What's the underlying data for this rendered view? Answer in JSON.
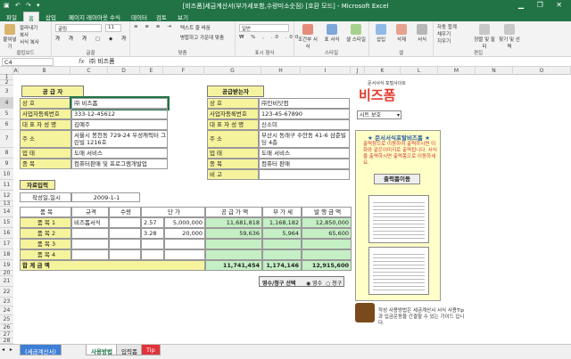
{
  "window": {
    "title": "[비즈폼]세금계산서(부가세포함,수량미소숫점) [호환 모드] - Microsoft Excel"
  },
  "ribbon_tabs": [
    "파일",
    "홈",
    "삽입",
    "페이지 레이아웃",
    "수식",
    "데이터",
    "검토",
    "보기"
  ],
  "ribbon": {
    "clipboard": {
      "paste": "붙여넣기",
      "cut": "잘라내기",
      "copy": "복사",
      "format_painter": "서식 복사",
      "label": "클립보드"
    },
    "font": {
      "name": "굴림",
      "size": "11",
      "label": "글꼴"
    },
    "alignment": {
      "wrap": "텍스트 줄 바꿈",
      "merge": "병합하고 가운데 맞춤",
      "label": "맞춤"
    },
    "number": {
      "format": "일반",
      "label": "표시 형식"
    },
    "styles": {
      "cond": "조건부 서식",
      "table": "표 서식",
      "cell": "셀 스타일",
      "label": "스타일"
    },
    "cells": {
      "insert": "삽입",
      "delete": "삭제",
      "format": "서식",
      "label": "셀"
    },
    "editing": {
      "autosum": "자동 합계",
      "fill": "채우기",
      "clear": "지우기",
      "sort": "정렬 및 필터",
      "find": "찾기 및 선택",
      "label": "편집"
    }
  },
  "formula_bar": {
    "name_box": "C4",
    "fx": "fx",
    "value": "㈜ 비즈폼"
  },
  "columns": [
    "A",
    "B",
    "C",
    "D",
    "E",
    "F",
    "G",
    "H",
    "I",
    "J",
    "K",
    "L",
    "M",
    "N",
    "O"
  ],
  "rows": [
    "1",
    "2",
    "3",
    "4",
    "5",
    "6",
    "7",
    "8",
    "9",
    "10",
    "11",
    "12",
    "13",
    "14",
    "15",
    "16",
    "17",
    "18",
    "19",
    "20",
    "21",
    "22",
    "23",
    "24",
    "25",
    "26",
    "27",
    "28"
  ],
  "supplier": {
    "header": "공 급 자",
    "labels": [
      "상 호",
      "사업자등록번호",
      "대 표 자 성 명",
      "주 소",
      "업 태",
      "종 목"
    ],
    "values": [
      "㈜ 비즈폼",
      "333-12-45612",
      "김예주",
      "서울시 봉천동 729-24 우성캐릭터 그린빌 1216호",
      "도매 서비스",
      "컴퓨터판매 및 프로그램개발업"
    ]
  },
  "buyer": {
    "header": "공급받는자",
    "labels": [
      "상 호",
      "사업자등록번호",
      "대 표 자 성 명",
      "주 소",
      "업 태",
      "종 목",
      "비 고"
    ],
    "values": [
      "㈜인비닷컴",
      "123-45-67890",
      "신소미",
      "부산시 동래구 수안동 41-6 삼준빌딩 4층",
      "도매 서비스",
      "컴퓨터 판매",
      ""
    ]
  },
  "input_section": {
    "header": "자료입력",
    "date_label": "작성일,일시",
    "date_value": "2009-1-1"
  },
  "items_table": {
    "headers": [
      "품 목",
      "규격",
      "수량",
      "단 가",
      "공 급 가 액",
      "부 가 세",
      "발 행 금 액"
    ],
    "rows": [
      {
        "label": "품 목 1",
        "name": "비즈폼서식",
        "spec": "",
        "qty": "2.57",
        "price": "5,000,000",
        "supply": "11,681,818",
        "tax": "1,168,182",
        "total": "12,850,000"
      },
      {
        "label": "품 목 2",
        "name": "",
        "spec": "",
        "qty": "3.28",
        "price": "20,000",
        "supply": "59,636",
        "tax": "5,964",
        "total": "65,600"
      },
      {
        "label": "품 목 3",
        "name": "",
        "spec": "",
        "qty": "",
        "price": "",
        "supply": "",
        "tax": "",
        "total": ""
      },
      {
        "label": "품 목 4",
        "name": "",
        "spec": "",
        "qty": "",
        "price": "",
        "supply": "",
        "tax": "",
        "total": ""
      }
    ],
    "total_label": "합 계 금 액",
    "total_supply": "11,741,454",
    "total_tax": "1,174,146",
    "total_amount": "12,915,600"
  },
  "receipt_option": {
    "label": "영수/청구 선택",
    "opt1": "영수",
    "opt2": "청구"
  },
  "side": {
    "logo_sub": "문서서식 포털사이트",
    "logo": "비즈폼",
    "dropdown": "시트 보호",
    "promo_title": "★ 문서서식포탈비즈폼 ★",
    "promo_text": "출력창으로 이동하여 출력하시면 이화와 같은이미지로 출력됩니다. 서식을 출력하시면 출력폼으로 이동하세요.",
    "print_button": "출력폼이동",
    "help_text": "작성 사용방법은 세금계산서 서식 사용Tip과 입금운동을 간결할 수 있는 가이드 입니다."
  },
  "sheet_tabs": [
    "(세금계산서)",
    "사용방법",
    "입력폼",
    "Tip"
  ]
}
